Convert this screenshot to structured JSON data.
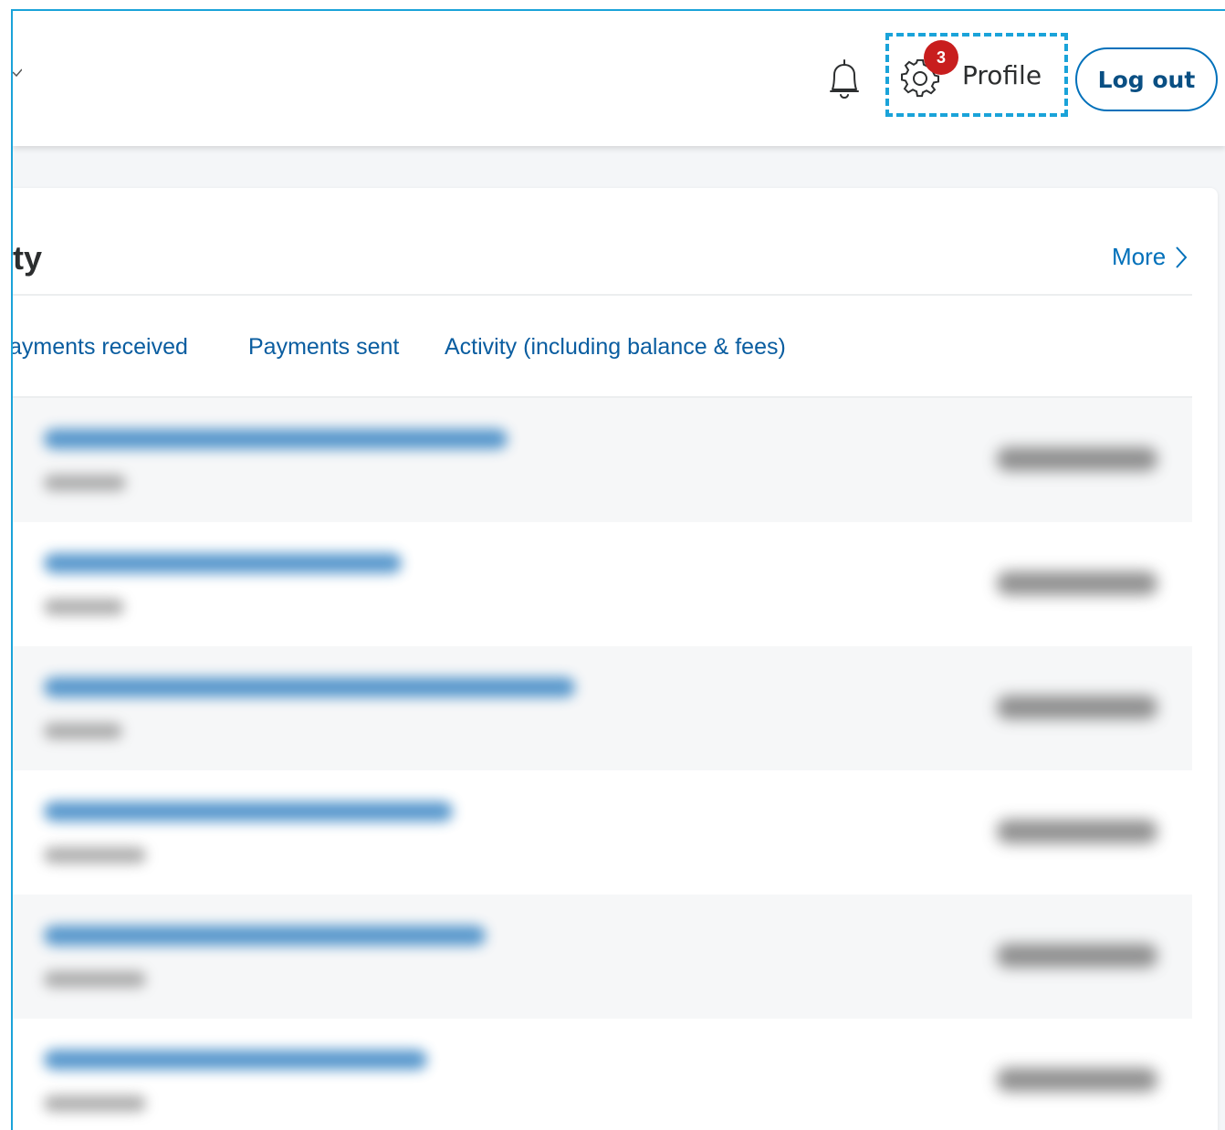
{
  "header": {
    "notification_badge": "3",
    "profile_label": "Profile",
    "logout_label": "Log out"
  },
  "activity": {
    "title": "Recent activity",
    "title_visible": "ty",
    "more_label": "More",
    "tabs": [
      {
        "label": "Payments received",
        "visible": "ayments received"
      },
      {
        "label": "Payments sent"
      },
      {
        "label": "Activity (including balance & fees)"
      }
    ],
    "rows_count_note": "blurred transaction rows"
  },
  "colors": {
    "accent": "#0070ba",
    "link": "#0a5da0",
    "badge": "#c81e1e",
    "highlight": "#1aa3d9"
  }
}
